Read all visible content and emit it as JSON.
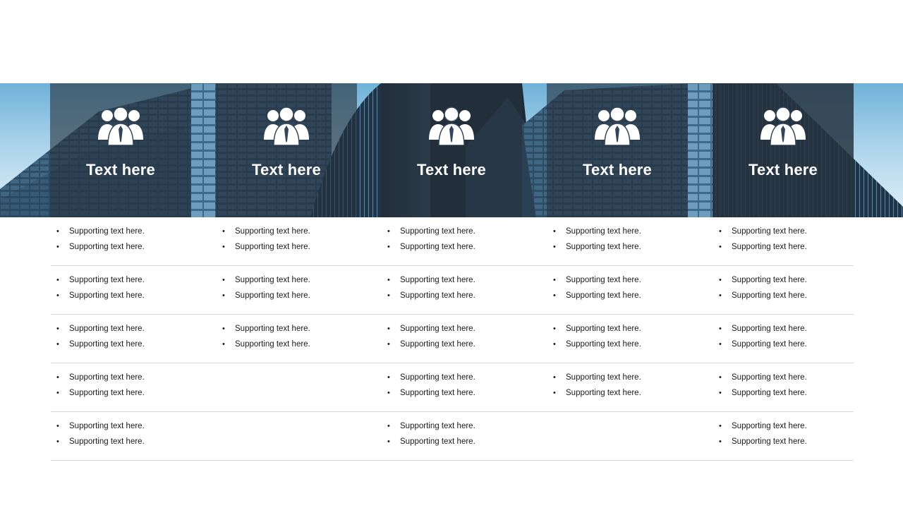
{
  "colors": {
    "overlay": "#26323e",
    "title_text": "#ffffff",
    "body_text": "#1a1a1a",
    "divider": "#d7d7d7",
    "sky": "#a9d2ea"
  },
  "icons": {
    "panel_icon": "people-group-icon"
  },
  "columns": [
    {
      "title": "Text here"
    },
    {
      "title": "Text here"
    },
    {
      "title": "Text here"
    },
    {
      "title": "Text here"
    },
    {
      "title": "Text here"
    }
  ],
  "rows": [
    [
      [
        "Supporting text here.",
        "Supporting text here."
      ],
      [
        "Supporting text here.",
        "Supporting text here."
      ],
      [
        "Supporting text here.",
        "Supporting text here."
      ],
      [
        "Supporting text here.",
        "Supporting text here."
      ],
      [
        "Supporting text here.",
        "Supporting text here."
      ]
    ],
    [
      [
        "Supporting text here.",
        "Supporting text here."
      ],
      [
        "Supporting text here.",
        "Supporting text here."
      ],
      [
        "Supporting text here.",
        "Supporting text here."
      ],
      [
        "Supporting text here.",
        "Supporting text here."
      ],
      [
        "Supporting text here.",
        "Supporting text here."
      ]
    ],
    [
      [
        "Supporting text here.",
        "Supporting text here."
      ],
      [
        "Supporting text here.",
        "Supporting text here."
      ],
      [
        "Supporting text here.",
        "Supporting text here."
      ],
      [
        "Supporting text here.",
        "Supporting text here."
      ],
      [
        "Supporting text here.",
        "Supporting text here."
      ]
    ],
    [
      [
        "Supporting text here.",
        "Supporting text here."
      ],
      [],
      [
        "Supporting text here.",
        "Supporting text here."
      ],
      [
        "Supporting text here.",
        "Supporting text here."
      ],
      [
        "Supporting text here.",
        "Supporting text here."
      ]
    ],
    [
      [
        "Supporting text here.",
        "Supporting text here."
      ],
      [],
      [
        "Supporting text here.",
        "Supporting text here."
      ],
      [],
      [
        "Supporting text here.",
        "Supporting text here."
      ]
    ]
  ]
}
